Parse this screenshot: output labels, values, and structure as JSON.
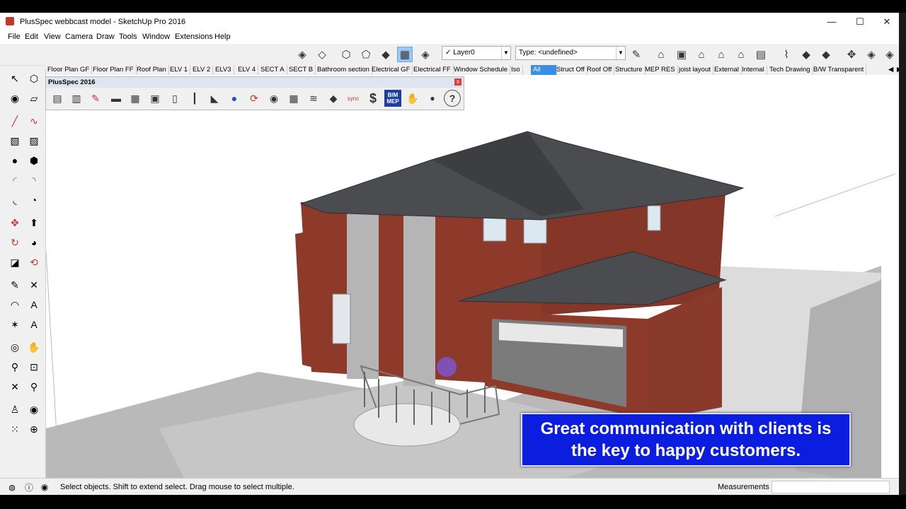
{
  "window": {
    "title": "PlusSpec webbcast model - SketchUp Pro 2016",
    "minimize": "—",
    "maximize": "☐",
    "close": "✕"
  },
  "menu": [
    "File",
    "Edit",
    "View",
    "Camera",
    "Draw",
    "Tools",
    "Window",
    "Extensions",
    "Help"
  ],
  "layer_combo": {
    "check": "✓",
    "value": "Layer0"
  },
  "type_combo": {
    "value": "Type: <undefined>"
  },
  "scenes": [
    "Floor Plan GF",
    "Floor Plan FF",
    "Roof Plan",
    "ELV 1",
    "ELV 2",
    "ELV3",
    "ELV 4",
    "SECT A",
    "SECT B",
    "Bathroom section",
    "Electrical GF",
    "Electrical FF",
    "Window Schedule",
    "Iso",
    "All",
    "Struct Off",
    "Roof Off",
    "Structure",
    "MEP RES",
    "joist layout",
    "External",
    "Internal",
    "Tech Drawing",
    "B/W Transparent"
  ],
  "active_scene": "All",
  "plusspec": {
    "title": "PlusSpec 2016",
    "close": "x",
    "sync_label": "sync",
    "dollar": "$",
    "bim_mep": "BIM MEP",
    "help": "?"
  },
  "status": {
    "hint": "Select objects. Shift to extend select. Drag mouse to select multiple.",
    "measurements_label": "Measurements",
    "measurements_value": ""
  },
  "caption": {
    "line1": "Great communication with clients is",
    "line2": "the key to happy customers."
  },
  "colors": {
    "brick": "#8e3a2a",
    "roof": "#4a4c4f",
    "caption_bg": "#0b1ee0",
    "active_tab": "#3b8ee6"
  }
}
